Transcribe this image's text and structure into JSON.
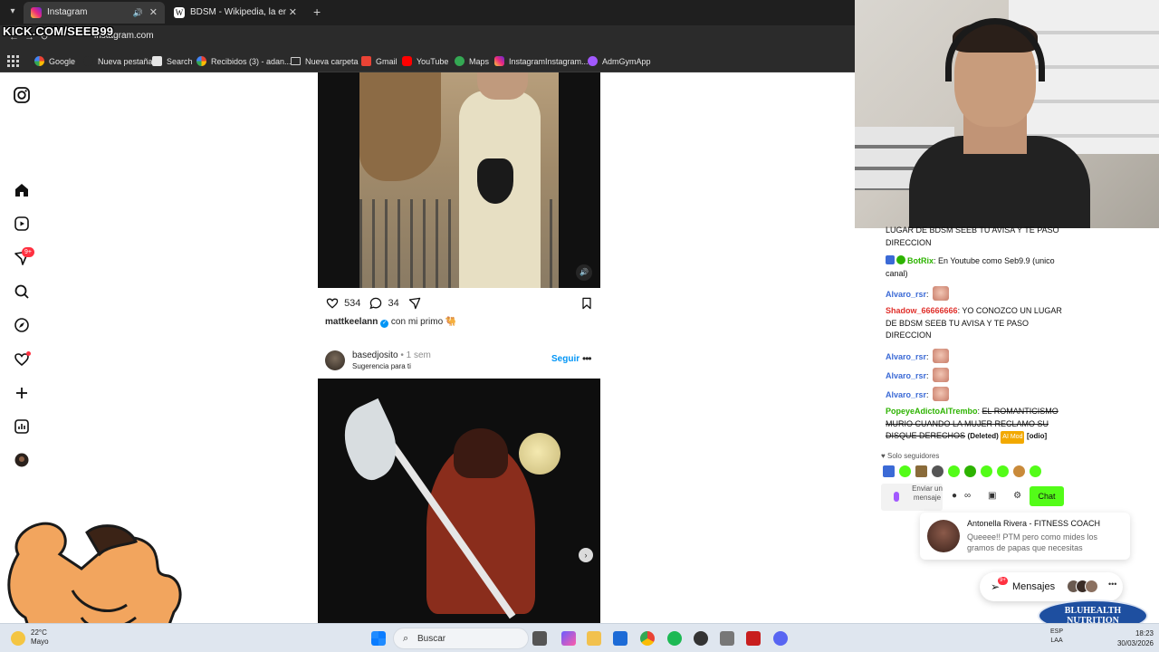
{
  "browser": {
    "tabs": [
      {
        "label": "Instagram",
        "active": true
      },
      {
        "label": "BDSM - Wikipedia, la enciclope",
        "active": false
      }
    ],
    "url": "instagram.com",
    "stream_overlay_text": "KICK.COM/SEEB99",
    "bookmarks": [
      "Google",
      "Nueva pestaña",
      "Search",
      "Recibidos (3) - adan...",
      "Nueva carpeta",
      "Gmail",
      "YouTube",
      "Maps",
      "InstagramInstagram...",
      "AdmGymApp"
    ]
  },
  "instagram": {
    "nav_icons": [
      "instagram-icon",
      "home-icon",
      "reels-icon",
      "messages-icon",
      "search-icon",
      "explore-icon",
      "notifications-icon",
      "create-icon",
      "dashboard-icon",
      "profile-avatar"
    ],
    "messages_badge": "9+",
    "post1": {
      "likes": "534",
      "comments": "34",
      "username": "mattkeelann",
      "caption": "con mi primo 🐫"
    },
    "post2": {
      "username": "basedjosito",
      "time": "1 sem",
      "subtitle": "Sugerencia para ti",
      "follow_label": "Seguir"
    }
  },
  "chat": {
    "messages": [
      {
        "user": "",
        "text": "LUGAR DE BDSM SEEB TU AVISA Y TE PASO DIRECCION",
        "color": "#111111"
      },
      {
        "user": "BotRix",
        "text": "En Youtube como Seb9.9 (unico canal)",
        "color": "#2db300"
      },
      {
        "user": "Alvaro_rsr",
        "text": "",
        "color": "#3b6ad6",
        "emote": true
      },
      {
        "user": "Shadow_66666666",
        "text": "YO CONOZCO UN LUGAR DE BDSM SEEB TU AVISA Y TE PASO DIRECCION",
        "color": "#e0302b"
      },
      {
        "user": "Alvaro_rsr",
        "text": "",
        "color": "#3b6ad6",
        "emote": true
      },
      {
        "user": "Alvaro_rsr",
        "text": "",
        "color": "#3b6ad6",
        "emote": true
      },
      {
        "user": "Alvaro_rsr",
        "text": "",
        "color": "#3b6ad6",
        "emote": true
      },
      {
        "user": "PopeyeAdictoAlTrembo",
        "text": "EL ROMANTICISMO MURIO CUANDO LA MUJER RECLAMO SU DISQUE DERECHOS",
        "color": "#2db300",
        "deleted": "(Deleted)",
        "mod_tag": "AI Mod",
        "reason": "[odio]"
      }
    ],
    "followers_only": "Solo seguidores",
    "input_placeholder": "Enviar un mensaje",
    "send_label": "Chat"
  },
  "notification": {
    "name": "Antonella Rivera - FITNESS COACH",
    "text": "Queeee!! PTM pero como mides los gramos de papas que necesitas"
  },
  "messages_pill": {
    "label": "Mensajes",
    "badge": "9+"
  },
  "sponsor": {
    "line1": "BLUHEALTH",
    "line2": "NUTRITION"
  },
  "taskbar": {
    "weather_temp": "22°C",
    "weather_desc": "Mayo",
    "search_placeholder": "Buscar",
    "lang_top": "ESP",
    "lang_bottom": "LAA",
    "time": "18:23",
    "date": "30/03/2026"
  }
}
